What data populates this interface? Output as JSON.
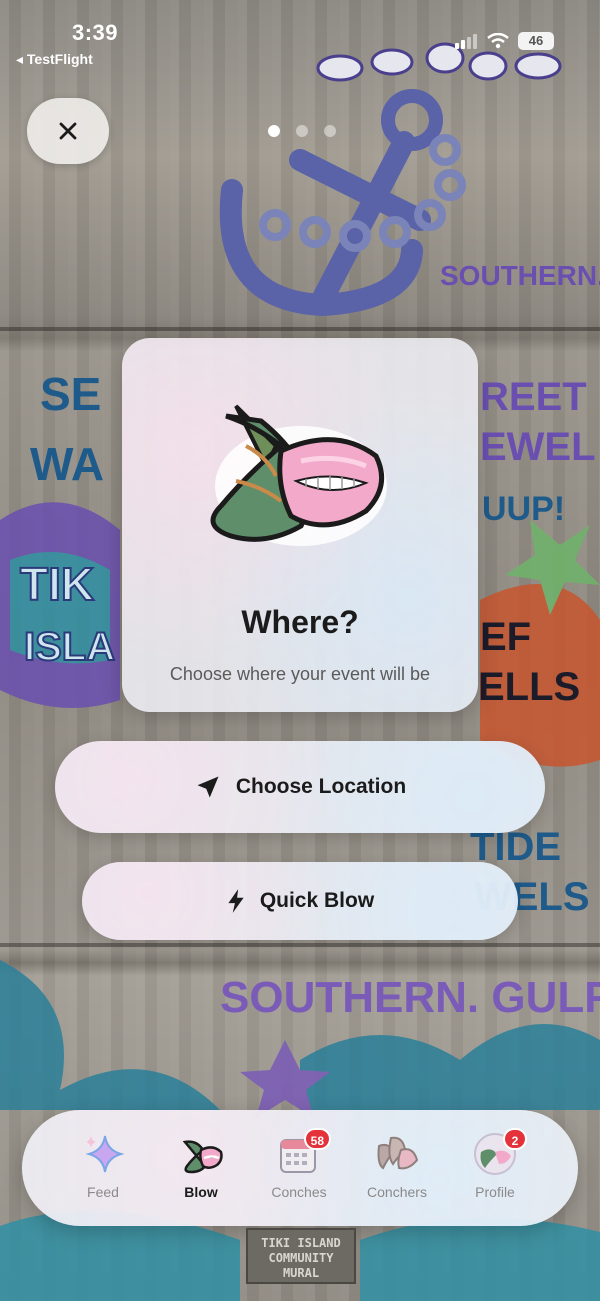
{
  "status_bar": {
    "time": "3:39",
    "back_app": "◂ TestFlight",
    "battery": "46"
  },
  "close_button": {
    "icon": "close-icon"
  },
  "pager": {
    "count": 3,
    "active_index": 0
  },
  "card": {
    "title": "Where?",
    "subtitle": "Choose where your event will be"
  },
  "actions": {
    "choose_location": "Choose Location",
    "quick_blow": "Quick Blow"
  },
  "tabs": [
    {
      "label": "Feed",
      "icon": "sparkle-icon",
      "badge": ""
    },
    {
      "label": "Blow",
      "icon": "conch-icon",
      "badge": ""
    },
    {
      "label": "Conches",
      "icon": "calendar-icon",
      "badge": "58"
    },
    {
      "label": "Conchers",
      "icon": "shells-icon",
      "badge": ""
    },
    {
      "label": "Profile",
      "icon": "avatar-icon",
      "badge": "2"
    }
  ],
  "mural": {
    "wall_text_1": "SOUTHERN. GULF.",
    "wall_text_2": "SOUTHERN. GULF.",
    "plaque": "TIKI ISLAND COMMUNITY MURAL"
  },
  "colors": {
    "badge": "#e4323a",
    "mural_purple": "#6a4fb0",
    "mural_teal": "#2f8fa3",
    "text_dark": "#1b1b1b"
  }
}
